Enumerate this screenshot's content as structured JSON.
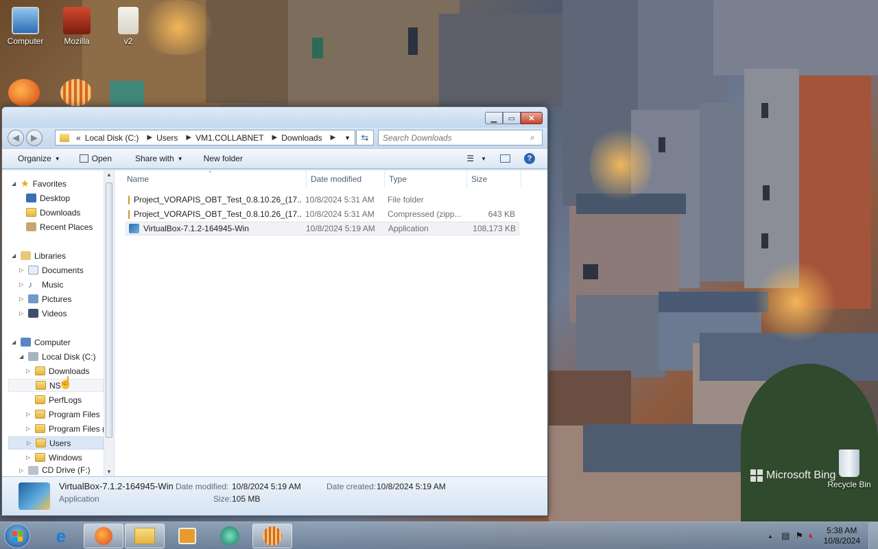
{
  "desktop": {
    "icons": [
      {
        "label": "Computer",
        "icon": "computer-icon"
      },
      {
        "label": "Mozilla",
        "icon": "mozilla-icon"
      },
      {
        "label": "v2",
        "icon": "folder-icon"
      }
    ],
    "recycle_bin": "Recycle Bin",
    "bing_watermark": "Microsoft Bing"
  },
  "window": {
    "caption_buttons": {
      "minimize": "▁",
      "maximize": "▭",
      "close": "✕"
    },
    "address": {
      "overflow": "«",
      "crumbs": [
        "Local Disk (C:)",
        "Users",
        "VM1.COLLABNET",
        "Downloads"
      ]
    },
    "search_placeholder": "Search Downloads",
    "toolbar": {
      "organize": "Organize",
      "open": "Open",
      "share_with": "Share with",
      "new_folder": "New folder"
    },
    "nav": {
      "favorites": {
        "label": "Favorites",
        "items": [
          "Desktop",
          "Downloads",
          "Recent Places"
        ]
      },
      "libraries": {
        "label": "Libraries",
        "items": [
          "Documents",
          "Music",
          "Pictures",
          "Videos"
        ]
      },
      "computer": {
        "label": "Computer"
      },
      "local_disk": {
        "label": "Local Disk (C:)"
      },
      "disk_children": [
        "Downloads",
        "NS",
        "PerfLogs",
        "Program Files",
        "Program Files (",
        "Users",
        "Windows"
      ],
      "cd_drive": "CD Drive (F:)"
    },
    "columns": {
      "name": "Name",
      "date": "Date modified",
      "type": "Type",
      "size": "Size"
    },
    "files": [
      {
        "name": "Project_VORAPIS_OBT_Test_0.8.10.26_(17...",
        "date": "10/8/2024 5:31 AM",
        "type": "File folder",
        "size": "",
        "icon": "folder-icon"
      },
      {
        "name": "Project_VORAPIS_OBT_Test_0.8.10.26_(17...",
        "date": "10/8/2024 5:31 AM",
        "type": "Compressed (zipp...",
        "size": "643 KB",
        "icon": "zip-folder-icon"
      },
      {
        "name": "VirtualBox-7.1.2-164945-Win",
        "date": "10/8/2024 5:19 AM",
        "type": "Application",
        "size": "108,173 KB",
        "icon": "virtualbox-icon"
      }
    ],
    "details": {
      "name": "VirtualBox-7.1.2-164945-Win",
      "kind": "Application",
      "date_modified_label": "Date modified:",
      "date_modified": "10/8/2024 5:19 AM",
      "size_label": "Size:",
      "size": "105 MB",
      "date_created_label": "Date created:",
      "date_created": "10/8/2024 5:19 AM"
    }
  },
  "taskbar": {
    "clock_time": "5:38 AM",
    "clock_date": "10/8/2024"
  }
}
